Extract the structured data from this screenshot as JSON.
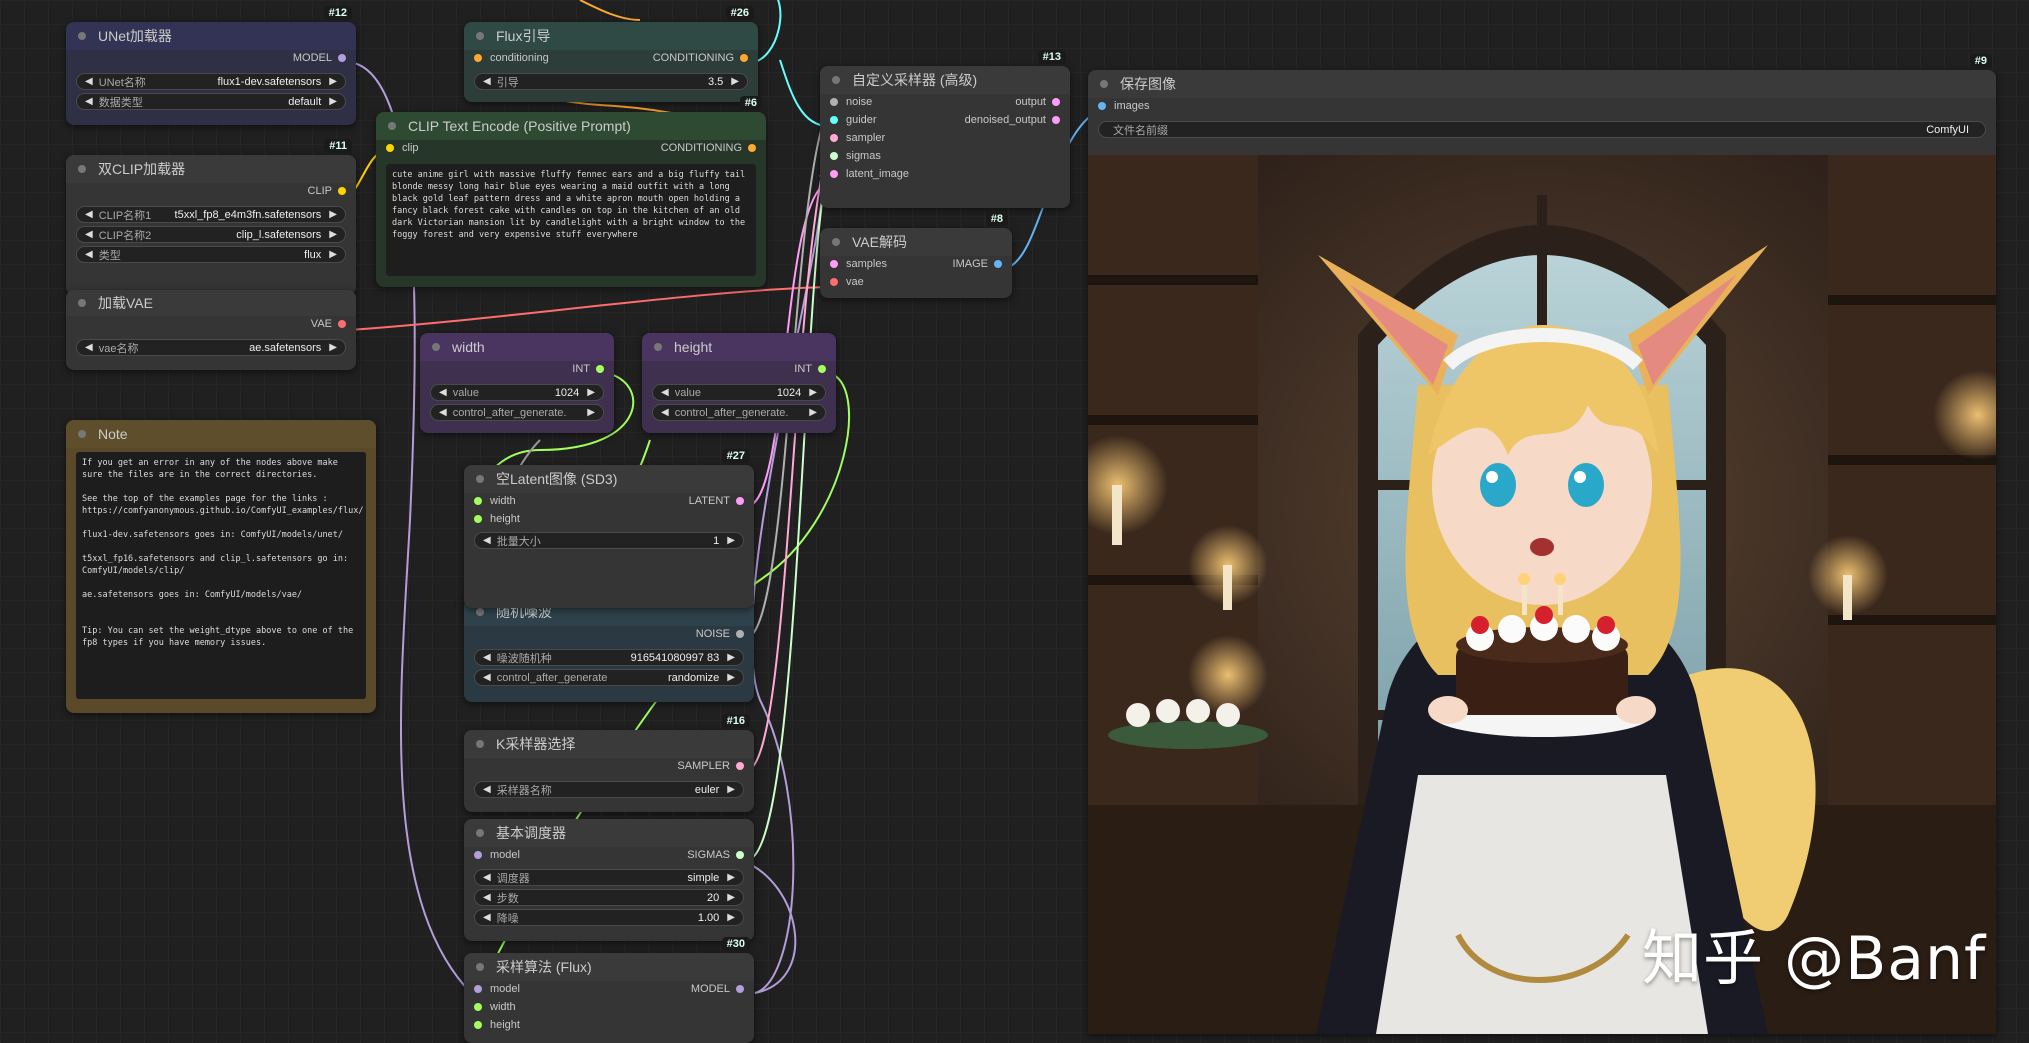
{
  "colors": {
    "model": "#b39ddb",
    "clip": "#ffd500",
    "conditioning": "#ffa931",
    "vae": "#ff6e6e",
    "latent": "#ff9cf9",
    "image": "#64b5f6",
    "int": "#a1ff5e",
    "noise": "#b0b0b0",
    "guider": "#66ffff",
    "sampler": "#ffaad4",
    "sigmas": "#cdffcd"
  },
  "nodes": {
    "unet": {
      "id": "#12",
      "title": "UNet加载器",
      "out_model": "MODEL",
      "w1_label": "UNet名称",
      "w1_value": "flux1-dev.safetensors",
      "w2_label": "数据类型",
      "w2_value": "default"
    },
    "dualclip": {
      "id": "#11",
      "title": "双CLIP加载器",
      "out_clip": "CLIP",
      "w1_label": "CLIP名称1",
      "w1_value": "t5xxl_fp8_e4m3fn.safetensors",
      "w2_label": "CLIP名称2",
      "w2_value": "clip_l.safetensors",
      "w3_label": "类型",
      "w3_value": "flux"
    },
    "vaeload": {
      "title": "加载VAE",
      "out_vae": "VAE",
      "w1_label": "vae名称",
      "w1_value": "ae.safetensors"
    },
    "note": {
      "title": "Note",
      "text": "If you get an error in any of the nodes above make sure the files are in the correct directories.\n\nSee the top of the examples page for the links : https://comfyanonymous.github.io/ComfyUI_examples/flux/\n\nflux1-dev.safetensors goes in: ComfyUI/models/unet/\n\nt5xxl_fp16.safetensors and clip_l.safetensors go in: ComfyUI/models/clip/\n\nae.safetensors goes in: ComfyUI/models/vae/\n\n\nTip: You can set the weight_dtype above to one of the fp8 types if you have memory issues."
    },
    "fluxguide": {
      "id": "#26",
      "title": "Flux引导",
      "in_cond": "conditioning",
      "out_cond": "CONDITIONING",
      "w1_label": "引导",
      "w1_value": "3.5"
    },
    "clipenc": {
      "id": "#6",
      "title": "CLIP Text Encode (Positive Prompt)",
      "in_clip": "clip",
      "out_cond": "CONDITIONING",
      "text": "cute anime girl with massive fluffy fennec ears and a big fluffy tail blonde messy long hair blue eyes wearing a maid outfit with a long black gold leaf pattern dress and a white apron mouth open holding a fancy black forest cake with candles on top in the kitchen of an old dark Victorian mansion lit by candlelight with a bright window to the foggy forest and very expensive stuff everywhere"
    },
    "width": {
      "title": "width",
      "out_int": "INT",
      "w1_label": "value",
      "w1_value": "1024",
      "w2_label": "control_after_generate."
    },
    "height": {
      "title": "height",
      "out_int": "INT",
      "w1_label": "value",
      "w1_value": "1024",
      "w2_label": "control_after_generate."
    },
    "emptylatent": {
      "id": "#27",
      "title": "空Latent图像 (SD3)",
      "in_width": "width",
      "in_height": "height",
      "out_latent": "LATENT",
      "w1_label": "批量大小",
      "w1_value": "1"
    },
    "noise": {
      "title": "随机噪波",
      "out_noise": "NOISE",
      "w1_label": "噪波随机种",
      "w1_value": "916541080997 83",
      "w2_label": "control_after_generate",
      "w2_value": "randomize"
    },
    "ksel": {
      "id": "#16",
      "title": "K采样器选择",
      "out_sampler": "SAMPLER",
      "w1_label": "采样器名称",
      "w1_value": "euler"
    },
    "sched": {
      "title": "基本调度器",
      "in_model": "model",
      "out_sigmas": "SIGMAS",
      "w1_label": "调度器",
      "w1_value": "simple",
      "w2_label": "步数",
      "w2_value": "20",
      "w3_label": "降噪",
      "w3_value": "1.00"
    },
    "modelsamp": {
      "id": "#30",
      "title": "采样算法 (Flux)",
      "in_model": "model",
      "in_width": "width",
      "in_height": "height",
      "out_model": "MODEL"
    },
    "custsamp": {
      "id": "#13",
      "title": "自定义采样器 (高级)",
      "in_noise": "noise",
      "in_guider": "guider",
      "in_sampler": "sampler",
      "in_sigmas": "sigmas",
      "in_latent": "latent_image",
      "out_output": "output",
      "out_denoised": "denoised_output"
    },
    "vaedec": {
      "id": "#8",
      "title": "VAE解码",
      "in_samples": "samples",
      "in_vae": "vae",
      "out_image": "IMAGE"
    },
    "save": {
      "id": "#9",
      "title": "保存图像",
      "in_images": "images",
      "w1_label": "文件名前缀",
      "w1_value": "ComfyUI"
    }
  },
  "watermark": "知乎 @Banf"
}
